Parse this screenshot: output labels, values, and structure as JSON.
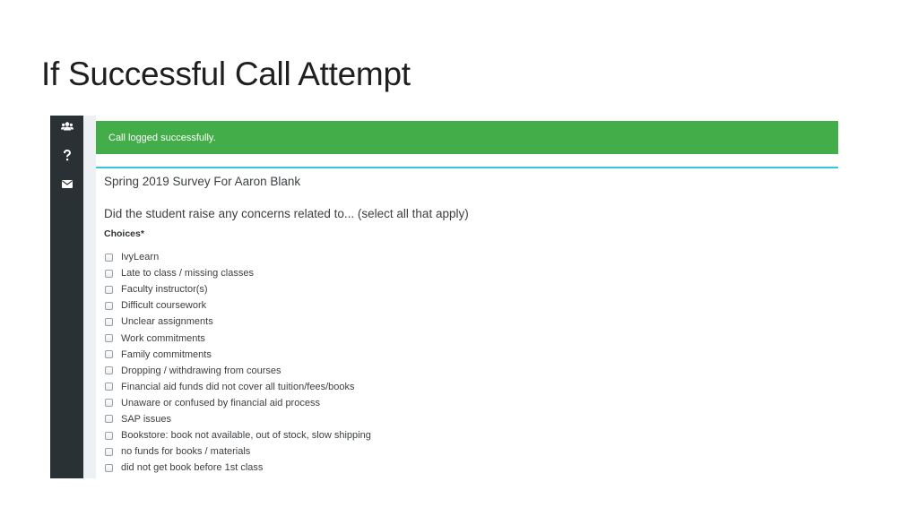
{
  "slide": {
    "title": "If Successful Call Attempt"
  },
  "sidebar": {
    "items": [
      {
        "icon": "users-icon"
      },
      {
        "icon": "question-icon"
      },
      {
        "icon": "envelope-icon"
      }
    ]
  },
  "alert": {
    "message": "Call logged successfully."
  },
  "survey": {
    "title": "Spring 2019 Survey For Aaron Blank",
    "question": "Did the student raise any concerns related to... (select all that apply)",
    "choices_label": "Choices*",
    "choices": [
      {
        "label": "IvyLearn",
        "checked": false
      },
      {
        "label": "Late to class / missing classes",
        "checked": false
      },
      {
        "label": "Faculty instructor(s)",
        "checked": false
      },
      {
        "label": "Difficult coursework",
        "checked": false
      },
      {
        "label": "Unclear assignments",
        "checked": false
      },
      {
        "label": "Work commitments",
        "checked": false
      },
      {
        "label": "Family commitments",
        "checked": false
      },
      {
        "label": "Dropping / withdrawing from courses",
        "checked": false
      },
      {
        "label": "Financial aid funds did not cover all tuition/fees/books",
        "checked": false
      },
      {
        "label": "Unaware or confused by financial aid process",
        "checked": false
      },
      {
        "label": "SAP issues",
        "checked": false
      },
      {
        "label": "Bookstore: book not available, out of stock, slow shipping",
        "checked": false
      },
      {
        "label": "no funds for books / materials",
        "checked": false
      },
      {
        "label": "did not get book before 1st class",
        "checked": false
      }
    ]
  },
  "colors": {
    "sidebar": "#2a3135",
    "alert_success": "#43ad49",
    "panel_accent": "#36c6e0",
    "text": "#3b3f42"
  }
}
